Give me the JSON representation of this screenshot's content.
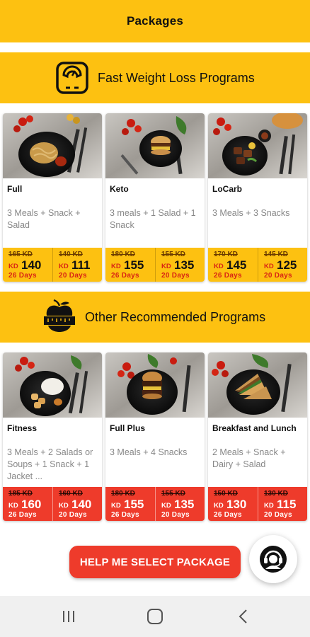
{
  "header": {
    "title": "Packages"
  },
  "colors": {
    "accent_yellow": "#FDC111",
    "accent_red": "#EE3B2B",
    "muted_text": "#888888"
  },
  "sections": [
    {
      "title": "Fast Weight Loss Programs",
      "icon": "weight-scale-icon",
      "packages": [
        {
          "name": "Full",
          "description": "3 Meals + Snack + Salad",
          "photo": "pasta-plate-photo",
          "prices": [
            {
              "old": "165 KD",
              "currency": "KD",
              "price": "140",
              "days": "26 Days"
            },
            {
              "old": "140 KD",
              "currency": "KD",
              "price": "111",
              "days": "20 Days"
            }
          ]
        },
        {
          "name": "Keto",
          "description": "3 meals + 1 Salad + 1 Snack",
          "photo": "burger-plate-photo",
          "prices": [
            {
              "old": "180 KD",
              "currency": "KD",
              "price": "155",
              "days": "26 Days"
            },
            {
              "old": "155 KD",
              "currency": "KD",
              "price": "135",
              "days": "20 Days"
            }
          ]
        },
        {
          "name": "LoCarb",
          "description": "3 Meals + 3 Snacks",
          "photo": "meat-plate-photo",
          "prices": [
            {
              "old": "170 KD",
              "currency": "KD",
              "price": "145",
              "days": "26 Days"
            },
            {
              "old": "145 KD",
              "currency": "KD",
              "price": "125",
              "days": "20 Days"
            }
          ]
        }
      ]
    },
    {
      "title": "Other Recommended Programs",
      "icon": "apple-measuring-tape-icon",
      "packages": [
        {
          "name": "Fitness",
          "description": "3 Meals + 2 Salads or Soups + 1 Snack + 1 Jacket ...",
          "photo": "rice-chicken-plate-photo",
          "prices": [
            {
              "old": "185 KD",
              "currency": "KD",
              "price": "160",
              "days": "26 Days"
            },
            {
              "old": "160 KD",
              "currency": "KD",
              "price": "140",
              "days": "20 Days"
            }
          ]
        },
        {
          "name": "Full Plus",
          "description": "3 Meals + 4 Snacks",
          "photo": "burger-plate-photo",
          "prices": [
            {
              "old": "180 KD",
              "currency": "KD",
              "price": "155",
              "days": "26 Days"
            },
            {
              "old": "155 KD",
              "currency": "KD",
              "price": "135",
              "days": "20 Days"
            }
          ]
        },
        {
          "name": "Breakfast and Lunch",
          "description": "2 Meals + Snack + Dairy + Salad",
          "photo": "sandwich-plate-photo",
          "prices": [
            {
              "old": "150 KD",
              "currency": "KD",
              "price": "130",
              "days": "26 Days"
            },
            {
              "old": "130 KD",
              "currency": "KD",
              "price": "115",
              "days": "20 Days"
            }
          ]
        }
      ]
    }
  ],
  "help_button": {
    "label": "HELP ME SELECT PACKAGE"
  },
  "support_button": {
    "icon": "customer-support-icon"
  },
  "navbar": {
    "icons": [
      "recent-apps-icon",
      "home-icon",
      "back-icon"
    ]
  }
}
